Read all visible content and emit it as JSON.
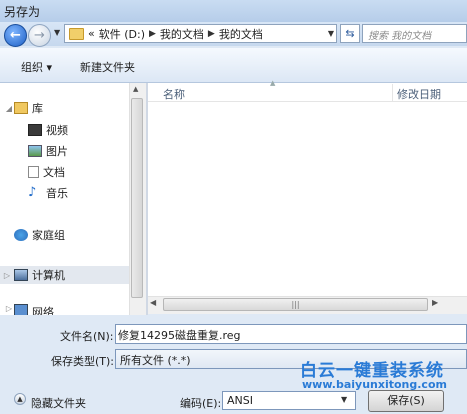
{
  "window": {
    "title": "另存为"
  },
  "nav": {
    "breadcrumb_prefix": "«",
    "breadcrumb": [
      "软件 (D:)",
      "我的文档",
      "我的文档"
    ],
    "search_placeholder": "搜索 我的文档"
  },
  "toolbar": {
    "organize_label": "组织 ▾",
    "newfolder_label": "新建文件夹"
  },
  "navpane": {
    "items": [
      {
        "label": "库",
        "icon": "library-icon",
        "level": 0
      },
      {
        "label": "视频",
        "icon": "video-icon",
        "level": 1
      },
      {
        "label": "图片",
        "icon": "picture-icon",
        "level": 1
      },
      {
        "label": "文档",
        "icon": "document-icon",
        "level": 1
      },
      {
        "label": "音乐",
        "icon": "music-icon",
        "level": 1
      },
      {
        "label": "家庭组",
        "icon": "homegroup-icon",
        "level": 0
      },
      {
        "label": "计算机",
        "icon": "computer-icon",
        "level": 0
      },
      {
        "label": "网络",
        "icon": "network-icon",
        "level": 0
      }
    ]
  },
  "filelist": {
    "col_name": "名称",
    "col_date": "修改日期"
  },
  "form": {
    "filename_label": "文件名(N):",
    "filename_value": "修复14295磁盘重复.reg",
    "filetype_label": "保存类型(T):",
    "filetype_value": "所有文件 (*.*)",
    "hide_folders_label": "隐藏文件夹",
    "encoding_label": "编码(E):",
    "encoding_value": "ANSI",
    "save_label": "保存(S)"
  },
  "watermark": {
    "line1": "白云一键重装系统",
    "line2": "www.baiyunxitong.com"
  },
  "colors": {
    "accent": "#2a7bd6",
    "title_bg": "#c9dcf2"
  }
}
